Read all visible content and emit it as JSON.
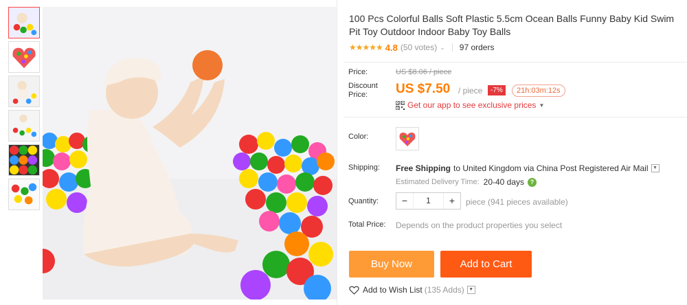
{
  "product": {
    "title": "100 Pcs Colorful Balls Soft Plastic 5.5cm Ocean Balls Funny Baby Kid Swim Pit Toy Outdoor Indoor Baby Toy Balls",
    "stars": "★★★★★",
    "rating": "4.8",
    "votes": "(50 votes)",
    "orders": "97 orders"
  },
  "price": {
    "label": "Price:",
    "original": "US $8.06 / piece",
    "discount_label_1": "Discount",
    "discount_label_2": "Price:",
    "current": "US $7.50",
    "per": "/ piece",
    "discount": "-7%",
    "timer": "21h:03m:12s",
    "app_promo": "Get our app to see exclusive prices"
  },
  "color": {
    "label": "Color:"
  },
  "shipping": {
    "label": "Shipping:",
    "free": "Free Shipping",
    "to": "to United Kingdom via China Post Registered Air Mail",
    "estimate_label": "Estimated Delivery Time:",
    "estimate_days": "20-40 days"
  },
  "quantity": {
    "label": "Quantity:",
    "value": "1",
    "minus": "−",
    "plus": "+",
    "available": "piece (941 pieces available)"
  },
  "total": {
    "label": "Total Price:",
    "note": "Depends on the product properties you select"
  },
  "actions": {
    "buy_now": "Buy Now",
    "add_to_cart": "Add to Cart",
    "wishlist": "Add to Wish List",
    "wishlist_count": "(135 Adds)"
  },
  "colors": {
    "accent_orange": "#ff7e00",
    "buy_button": "#ff9b37",
    "cart_button": "#ff5a14",
    "discount_red": "#e4393c"
  }
}
